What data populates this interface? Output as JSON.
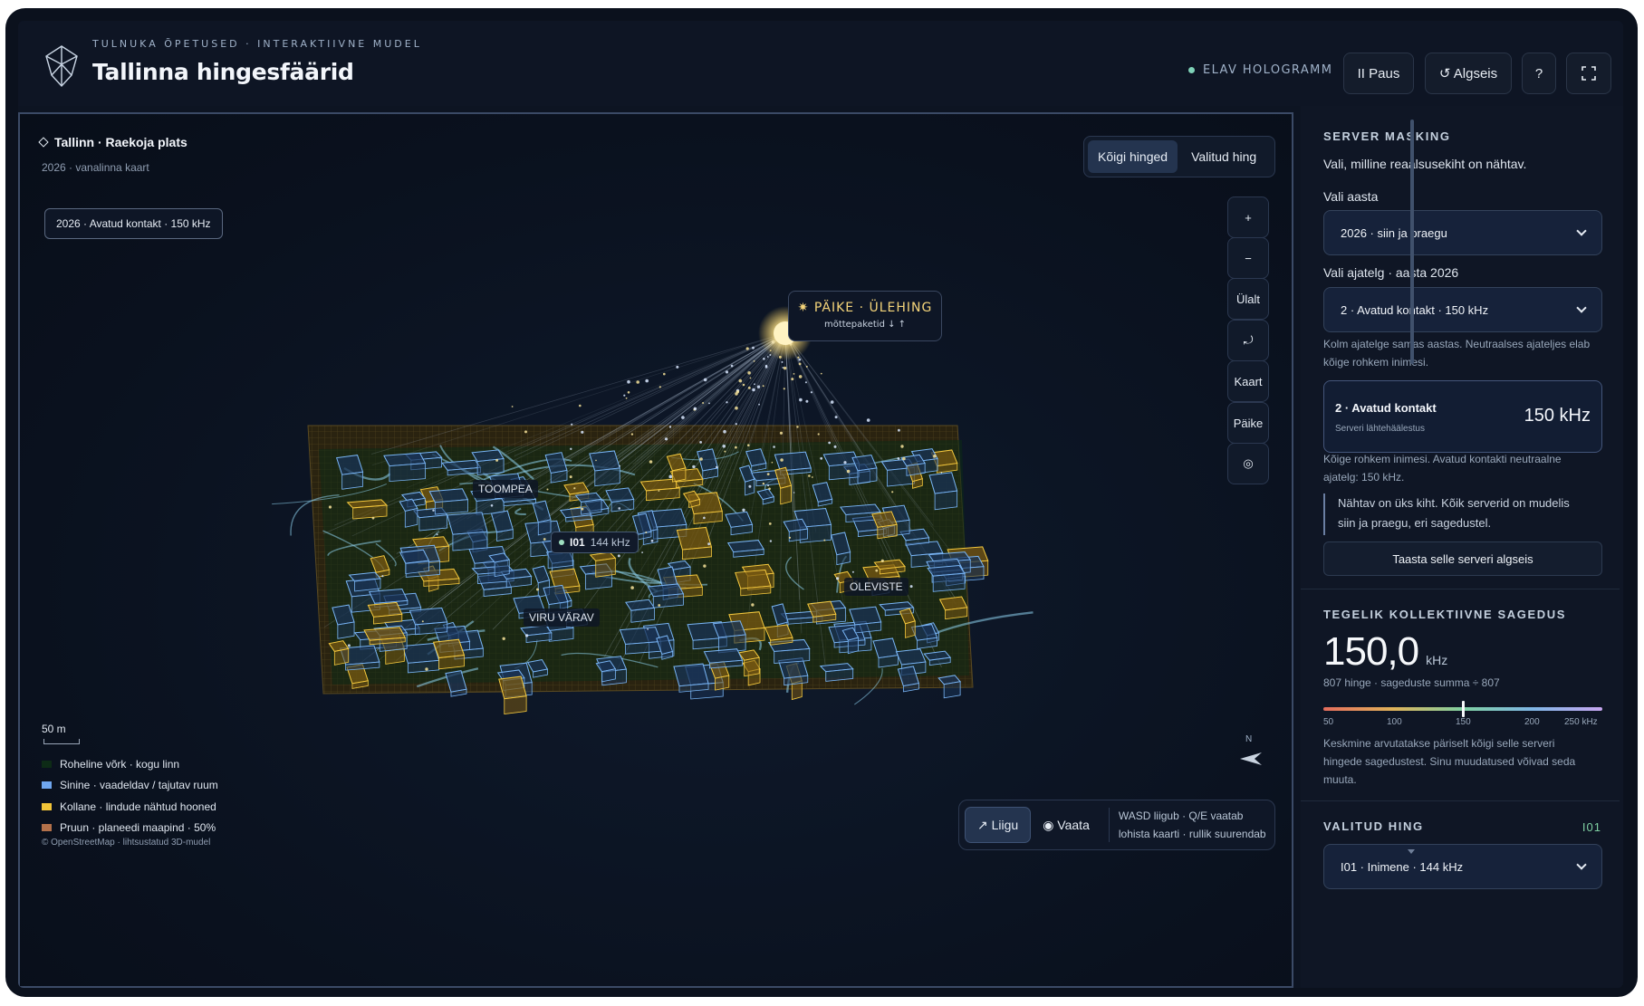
{
  "header": {
    "kicker": "TULNUKA ÕPETUSED · INTERAKTIIVNE MUDEL",
    "title": "Tallinna hingesfäärid",
    "live_status": "ELAV HOLOGRAMM",
    "pause_label": "II Paus",
    "reset_label": "↺ Algseis",
    "help_label": "?",
    "fullscreen_icon": "fullscreen-icon"
  },
  "map": {
    "location_title": "Tallinn · Raekoja plats",
    "location_subtitle": "2026 · vanalinna kaart",
    "layer_chip": "2026 · Avatud kontakt · 150 kHz",
    "segment": {
      "all": "Kõigi hinged",
      "selected": "Valitud hing",
      "active": "all"
    },
    "controls": {
      "zoom_in": "+",
      "zoom_out": "−",
      "top_view": "Ülalt",
      "rotate": "⤾",
      "map": "Kaart",
      "sun": "Päike",
      "locate": "◎"
    },
    "sun_label": {
      "title": "✷ PÄIKE · ÜLEHING",
      "subtitle": "mõttepaketid ↓ ↑"
    },
    "place_tags": {
      "toompea": "TOOMPEA",
      "viru": "VIRU VÄRAV",
      "oleviste": "OLEVISTE"
    },
    "soul_tag": {
      "id": "I01",
      "freq": "144 kHz"
    },
    "scale": "50 m",
    "legend": [
      {
        "label": "Roheline võrk · kogu linn",
        "color": "#0d2b16"
      },
      {
        "label": "Sinine · vaadeldav / tajutav ruum",
        "color": "#6fa6ef"
      },
      {
        "label": "Kollane · lindude nähtud hooned",
        "color": "#f2c438"
      },
      {
        "label": "Pruun · planeedi maapind · 50%",
        "color": "#b3714a"
      }
    ],
    "credit": "© OpenStreetMap · lihtsustatud 3D-mudel",
    "compass": "N",
    "mode": {
      "move": "↗ Liigu",
      "look": "◉ Vaata",
      "active": "move"
    },
    "hint_line1": "WASD liigub · Q/E vaatab",
    "hint_line2": "lohista kaarti · rullik suurendab"
  },
  "sidebar": {
    "masking": {
      "heading": "SERVER MASKING",
      "description": "Vali, milline reaalsusekiht on nähtav.",
      "year_label": "Vali aasta",
      "year_value": "2026 · siin ja praegu",
      "timeline_label": "Vali ajatelg · aasta 2026",
      "timeline_value": "2 · Avatud kontakt · 150 kHz",
      "timeline_note_1": "Kolm ajatelge samas aastas. Neutraalses ajateljes elab",
      "timeline_note_2": "kõige rohkem inimesi."
    },
    "server_card": {
      "title": "2 · Avatud kontakt",
      "subtitle": "Serveri lähtehäälestus",
      "value": "150 kHz"
    },
    "card_note_1": "Kõige rohkem inimesi. Avatud kontakti neutraalne",
    "card_note_2": "ajatelg: 150 kHz.",
    "quote_1": "Nähtav on üks kiht. Kõik serverid on mudelis",
    "quote_2": "siin ja praegu, eri sagedustel.",
    "restore_button": "Taasta selle serveri algseis",
    "collective": {
      "heading": "TEGELIK KOLLEKTIIVNE SAGEDUS",
      "value": "150,0",
      "unit": "kHz",
      "formula": "807 hinge · sageduste summa ÷ 807",
      "scale_ticks": [
        "50",
        "100",
        "150",
        "200",
        "250 kHz"
      ],
      "scale_min": 50,
      "scale_max": 250,
      "marker_value": 150,
      "note_1": "Keskmine arvutatakse päriselt kõigi selle serveri",
      "note_2": "hingede sagedustest. Sinu muudatused võivad seda",
      "note_3": "muuta."
    },
    "selected_soul": {
      "heading": "VALITUD HING",
      "id": "I01",
      "select_value": "I01 · Inimene · 144 kHz"
    }
  }
}
